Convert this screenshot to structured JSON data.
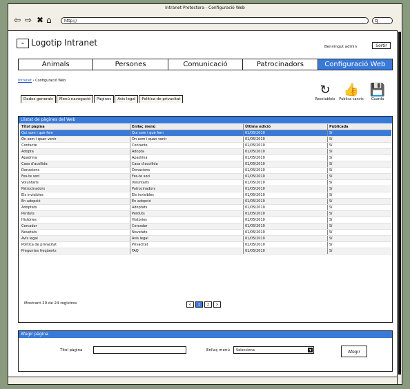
{
  "app": {
    "title": "Intranet Protectora - Configuració Web",
    "url": "http://",
    "search": "q"
  },
  "header": {
    "logo_text": "Logotip Intranet",
    "welcome": "Benvingut admin",
    "logout": "Sortir"
  },
  "menu": {
    "items": [
      {
        "label": "Animals"
      },
      {
        "label": "Persones"
      },
      {
        "label": "Comunicació"
      },
      {
        "label": "Patrocinadors"
      },
      {
        "label": "Configuració Web",
        "active": true
      }
    ]
  },
  "breadcrumb": {
    "link": "Intranet",
    "separator": "›",
    "current": "Configuració Web"
  },
  "tabs": [
    {
      "label": "Dades generals"
    },
    {
      "label": "Menú navegació"
    },
    {
      "label": "Pàgines",
      "active": true
    },
    {
      "label": "Avís legal"
    },
    {
      "label": "Política de privacitat"
    }
  ],
  "toolbar": [
    {
      "icon": "refresh-icon",
      "label": "Reestableix"
    },
    {
      "icon": "thumb-up-icon",
      "label": "Publica canvis"
    },
    {
      "icon": "save-icon",
      "label": "Guarda"
    }
  ],
  "list": {
    "title": "Llistat de pàgines del Web",
    "columns": [
      "Títol pàgina",
      "Enllaç menú",
      "Última edició",
      "Publicada"
    ],
    "rows": [
      [
        "Qui som i què fem",
        "Qui som i què fem",
        "01/05/2010",
        "Sí"
      ],
      [
        "On som i quan venir",
        "On som i quan venir",
        "01/05/2010",
        "Sí"
      ],
      [
        "Contacte",
        "Contacte",
        "01/05/2010",
        "Sí"
      ],
      [
        "Adopta",
        "Adopta",
        "01/05/2010",
        "Sí"
      ],
      [
        "Apadrina",
        "Apadrina",
        "01/05/2010",
        "Sí"
      ],
      [
        "Casa d'acollida",
        "Casa d'acollida",
        "01/05/2010",
        "Sí"
      ],
      [
        "Donacions",
        "Donacions",
        "01/05/2010",
        "Sí"
      ],
      [
        "Fes-te soci",
        "Fes-te soci",
        "01/05/2010",
        "Sí"
      ],
      [
        "Voluntaris",
        "Voluntaris",
        "01/05/2010",
        "Sí"
      ],
      [
        "Patrocinadors",
        "Patrocinadors",
        "01/05/2010",
        "Sí"
      ],
      [
        "Els invisibles",
        "Els invisibles",
        "01/05/2010",
        "Sí"
      ],
      [
        "En adopció",
        "En adopció",
        "01/05/2010",
        "Sí"
      ],
      [
        "Adoptats",
        "Adoptats",
        "01/05/2010",
        "Sí"
      ],
      [
        "Perduts",
        "Perduts",
        "01/05/2010",
        "Sí"
      ],
      [
        "Històries",
        "Històries",
        "01/05/2010",
        "Sí"
      ],
      [
        "Cercador",
        "Cercador",
        "01/05/2010",
        "Sí"
      ],
      [
        "Novetats",
        "Novetats",
        "01/05/2010",
        "Sí"
      ],
      [
        "Avís legal",
        "Avís legal",
        "01/05/2010",
        "Sí"
      ],
      [
        "Política de privacitat",
        "Privacitat",
        "01/05/2010",
        "Sí"
      ],
      [
        "Preguntes freqüents",
        "FAQ",
        "01/05/2010",
        "Sí"
      ]
    ],
    "count": "Mostrant 20 de 24 registres",
    "pager": [
      "<",
      "1",
      "2",
      ">"
    ],
    "pager_active": 1
  },
  "choose": {
    "title": "Afegir pàgina",
    "title_label": "Títol pàgina",
    "menu_label": "Enllaç menú",
    "select_value": "Selecciona",
    "button": "Afegir"
  },
  "colors": {
    "accent": "#3879d9"
  }
}
